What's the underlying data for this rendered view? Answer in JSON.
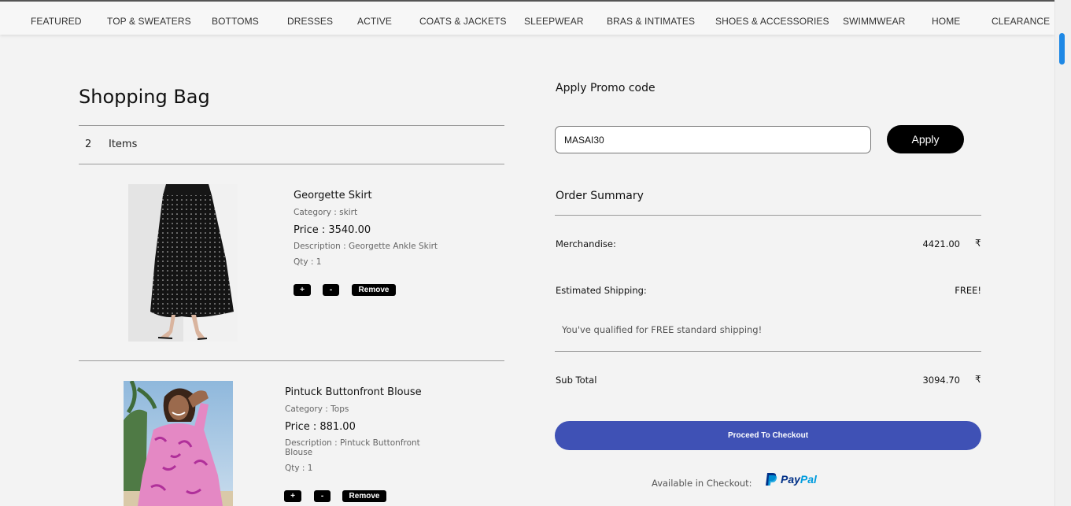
{
  "nav": {
    "items": [
      {
        "label": "FEATURED"
      },
      {
        "label": "TOP & SWEATERS"
      },
      {
        "label": "BOTTOMS"
      },
      {
        "label": "DRESSES"
      },
      {
        "label": "ACTIVE"
      },
      {
        "label": "COATS & JACKETS"
      },
      {
        "label": "SLEEPWEAR"
      },
      {
        "label": "BRAS & INTIMATES"
      },
      {
        "label": "SHOES & ACCESSORIES"
      },
      {
        "label": "SWIMMWEAR"
      },
      {
        "label": "HOME"
      },
      {
        "label": "CLEARANCE"
      }
    ]
  },
  "bag": {
    "title": "Shopping Bag",
    "item_count": "2",
    "items_label": "Items",
    "products": [
      {
        "name": "Georgette Skirt",
        "category": "Category : skirt",
        "price": "Price : 3540.00",
        "description": "Description : Georgette Ankle Skirt",
        "qty": "Qty : 1",
        "plus_label": "+",
        "minus_label": "-",
        "remove_label": "Remove"
      },
      {
        "name": "Pintuck Buttonfront Blouse",
        "category": "Category : Tops",
        "price": "Price : 881.00",
        "description": "Description : Pintuck Buttonfront Blouse",
        "qty": "Qty : 1",
        "plus_label": "+",
        "minus_label": "-",
        "remove_label": "Remove"
      }
    ]
  },
  "promo": {
    "title": "Apply Promo code",
    "value": "MASAI30",
    "apply_label": "Apply"
  },
  "summary": {
    "title": "Order Summary",
    "merchandise_label": "Merchandise:",
    "merchandise_value": "4421.00",
    "shipping_label": "Estimated Shipping:",
    "shipping_value": "FREE!",
    "shipping_note": "You've qualified for FREE standard shipping!",
    "subtotal_label": "Sub Total",
    "subtotal_value": "3094.70",
    "currency_symbol": "₹",
    "checkout_label": "Proceed To Checkout",
    "available_label": "Available in Checkout:",
    "paypal_label": "PayPal"
  },
  "colors": {
    "checkout": "#3f51b5",
    "paypal_dark": "#003087",
    "paypal_light": "#009cde",
    "scroll_thumb": "#1e88e5"
  }
}
